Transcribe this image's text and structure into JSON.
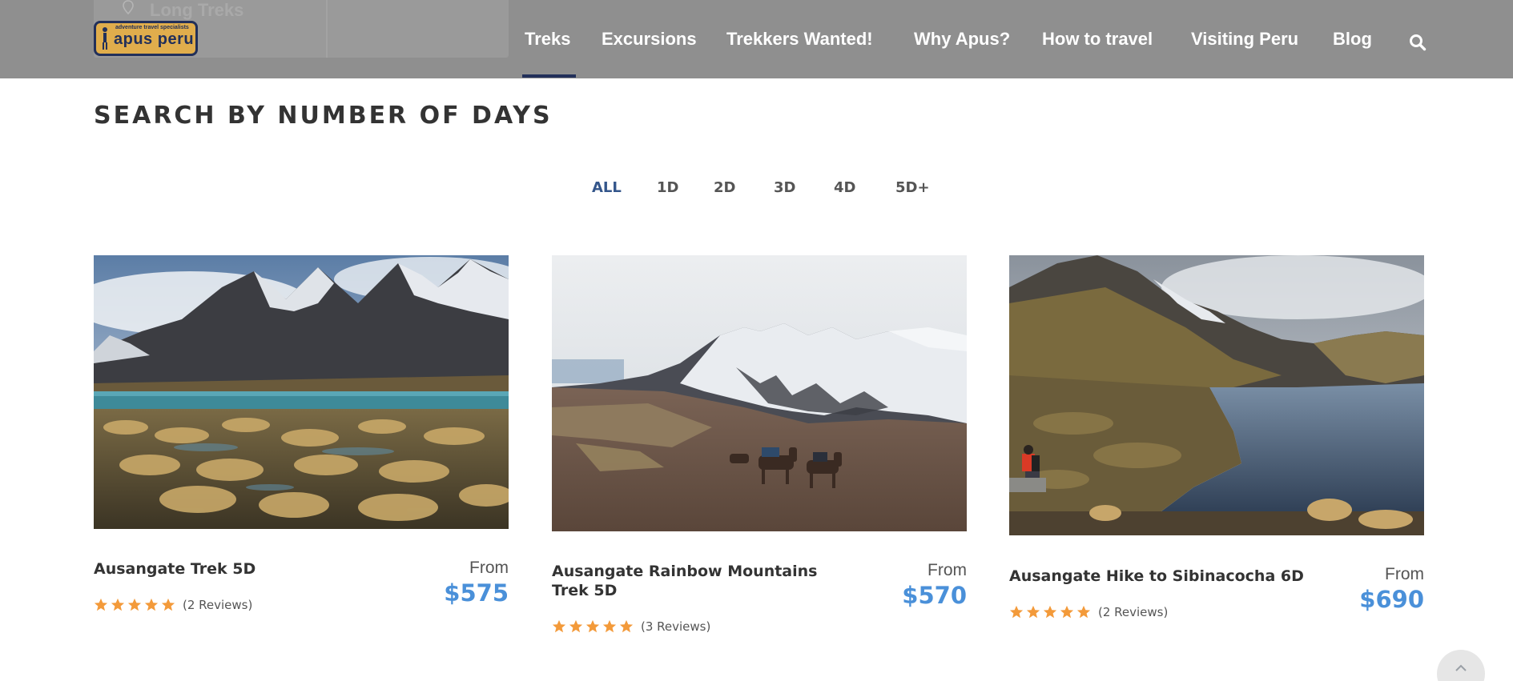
{
  "header": {
    "ghost_tab_label": "Long Treks",
    "logo": {
      "tagline": "adventure travel specialists",
      "name": "apus peru"
    },
    "nav": [
      {
        "label": "Treks",
        "active": true
      },
      {
        "label": "Excursions",
        "active": false
      },
      {
        "label": "Trekkers Wanted!",
        "active": false
      },
      {
        "label": "Why Apus?",
        "active": false
      },
      {
        "label": "How to travel",
        "active": false
      },
      {
        "label": "Visiting Peru",
        "active": false
      },
      {
        "label": "Blog",
        "active": false
      }
    ],
    "search_icon": "search-icon"
  },
  "section_title": "SEARCH BY NUMBER OF DAYS",
  "filters": [
    {
      "label": "ALL",
      "active": true
    },
    {
      "label": "1D",
      "active": false
    },
    {
      "label": "2D",
      "active": false
    },
    {
      "label": "3D",
      "active": false
    },
    {
      "label": "4D",
      "active": false
    },
    {
      "label": "5D+",
      "active": false
    }
  ],
  "tours": [
    {
      "title": "Ausangate Trek 5D",
      "from_label": "From",
      "price": "$575",
      "rating": 5,
      "reviews": "(2 Reviews)"
    },
    {
      "title": "Ausangate Rainbow Mountains Trek 5D",
      "from_label": "From",
      "price": "$570",
      "rating": 5,
      "reviews": "(3 Reviews)"
    },
    {
      "title": "Ausangate Hike to Sibinacocha 6D",
      "from_label": "From",
      "price": "$690",
      "rating": 5,
      "reviews": "(2 Reviews)"
    }
  ],
  "colors": {
    "header_bg": "#8f8f8f",
    "brand_navy": "#22305a",
    "price_blue": "#4a90d9",
    "star_orange": "#f39a3a",
    "filter_active": "#34568b"
  }
}
